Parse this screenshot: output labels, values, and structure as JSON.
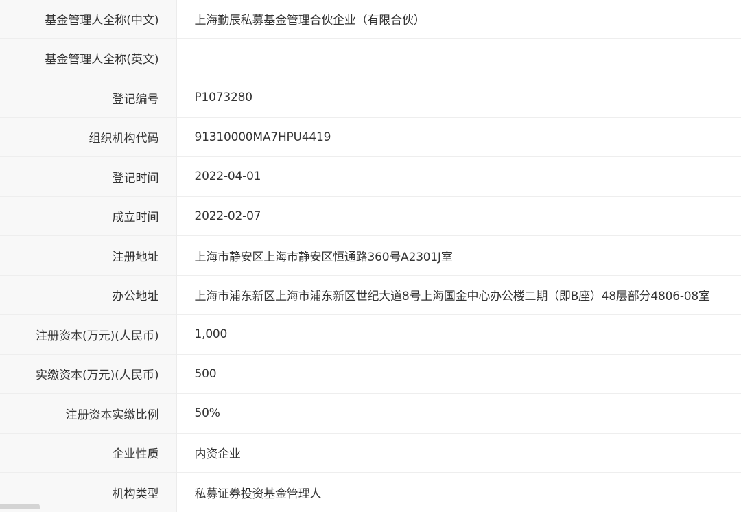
{
  "rows": [
    {
      "label": "基金管理人全称(中文)",
      "value": "上海勤辰私募基金管理合伙企业（有限合伙）"
    },
    {
      "label": "基金管理人全称(英文)",
      "value": ""
    },
    {
      "label": "登记编号",
      "value": "P1073280"
    },
    {
      "label": "组织机构代码",
      "value": "91310000MA7HPU4419"
    },
    {
      "label": "登记时间",
      "value": "2022-04-01"
    },
    {
      "label": "成立时间",
      "value": "2022-02-07"
    },
    {
      "label": "注册地址",
      "value": "上海市静安区上海市静安区恒通路360号A2301J室"
    },
    {
      "label": "办公地址",
      "value": "上海市浦东新区上海市浦东新区世纪大道8号上海国金中心办公楼二期（即B座）48层部分4806-08室"
    },
    {
      "label": "注册资本(万元)(人民币)",
      "value": "1,000"
    },
    {
      "label": "实缴资本(万元)(人民币)",
      "value": "500"
    },
    {
      "label": "注册资本实缴比例",
      "value": "50%"
    },
    {
      "label": "企业性质",
      "value": "内资企业"
    },
    {
      "label": "机构类型",
      "value": "私募证券投资基金管理人"
    }
  ]
}
